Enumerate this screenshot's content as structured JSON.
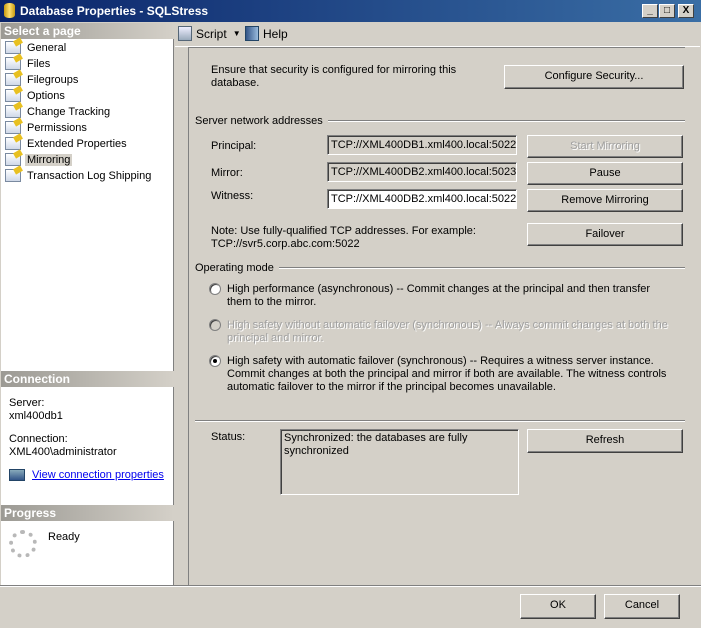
{
  "window": {
    "title": "Database Properties - SQLStress",
    "min": "_",
    "max": "□",
    "close": "X"
  },
  "sidebar": {
    "header": "Select a page",
    "items": [
      {
        "label": "General"
      },
      {
        "label": "Files"
      },
      {
        "label": "Filegroups"
      },
      {
        "label": "Options"
      },
      {
        "label": "Change Tracking"
      },
      {
        "label": "Permissions"
      },
      {
        "label": "Extended Properties"
      },
      {
        "label": "Mirroring"
      },
      {
        "label": "Transaction Log Shipping"
      }
    ],
    "selected": "Mirroring",
    "connection": {
      "header": "Connection",
      "server_label": "Server:",
      "server": "xml400db1",
      "connection_label": "Connection:",
      "connection": "XML400\\administrator",
      "link": "View connection properties"
    },
    "progress": {
      "header": "Progress",
      "status": "Ready"
    }
  },
  "toolbar": {
    "script": "Script",
    "help": "Help"
  },
  "main": {
    "security_text": "Ensure that security is configured for mirroring this database.",
    "configure_security": "Configure Security...",
    "addresses_group": "Server network addresses",
    "principal_label": "Principal:",
    "principal": "TCP://XML400DB1.xml400.local:5022",
    "mirror_label": "Mirror:",
    "mirror": "TCP://XML400DB2.xml400.local:5023",
    "witness_label": "Witness:",
    "witness": "TCP://XML400DB2.xml400.local:5022",
    "start_mirroring": "Start Mirroring",
    "pause": "Pause",
    "remove_mirroring": "Remove Mirroring",
    "failover": "Failover",
    "note": "Note: Use fully-qualified TCP addresses. For example: TCP://svr5.corp.abc.com:5022",
    "mode_group": "Operating mode",
    "modes": [
      {
        "label": "High performance (asynchronous) -- Commit changes at the principal and then transfer them to the mirror.",
        "checked": false,
        "enabled": true
      },
      {
        "label": "High safety without automatic failover (synchronous) -- Always commit changes at both the principal and mirror.",
        "checked": false,
        "enabled": false
      },
      {
        "label": "High safety with automatic failover (synchronous) -- Requires a witness server instance. Commit changes at both the principal and mirror if both are available. The witness controls automatic failover to the mirror if the principal becomes unavailable.",
        "checked": true,
        "enabled": true
      }
    ],
    "status_label": "Status:",
    "status": "Synchronized: the databases are fully synchronized",
    "refresh": "Refresh"
  },
  "footer": {
    "ok": "OK",
    "cancel": "Cancel"
  }
}
